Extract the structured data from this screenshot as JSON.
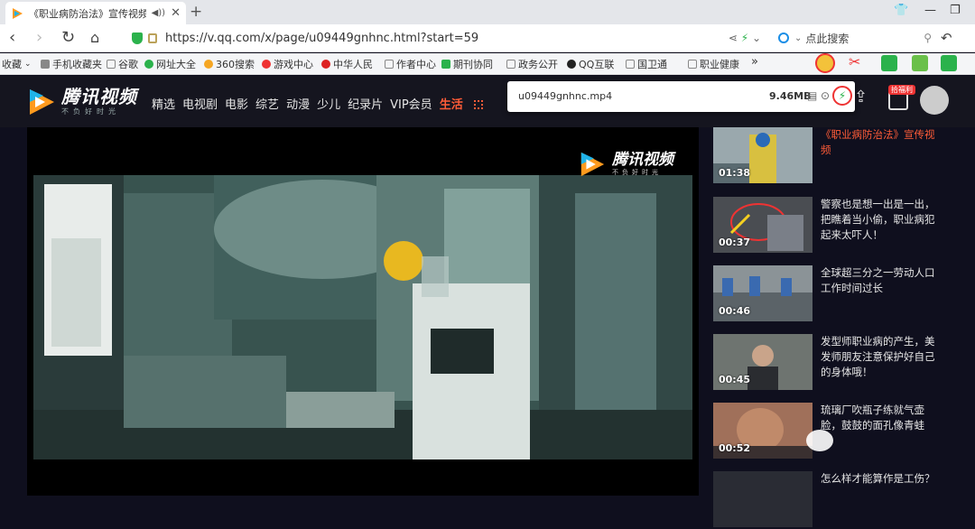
{
  "browser": {
    "tab_title": "《职业病防治法》宣传视频",
    "url": "https://v.qq.com/x/page/u09449gnhnc.html?start=59",
    "search_placeholder": "点此搜索"
  },
  "bookmarks": [
    "收藏",
    "手机收藏夹",
    "谷歌",
    "网址大全",
    "360搜索",
    "游戏中心",
    "中华人民",
    "作者中心",
    "期刊协同",
    "政务公开",
    "QQ互联",
    "国卫通",
    "职业健康"
  ],
  "bookmark_more": "»",
  "site": {
    "logo_text": "腾讯视频",
    "logo_slogan": "不负好时光",
    "nav": [
      "精选",
      "电视剧",
      "电影",
      "综艺",
      "动漫",
      "少儿",
      "纪录片",
      "VIP会员"
    ],
    "nav_hot": "生活",
    "badge": "拾福利"
  },
  "download": {
    "filename": "u09449gnhnc.mp4",
    "size": "9.46MB"
  },
  "player": {
    "watermark_text": "腾讯视频",
    "watermark_sub": "不负好时光"
  },
  "playlist": [
    {
      "title": "《职业病防治法》宣传视频",
      "duration": "01:38",
      "active": true
    },
    {
      "title": "警察也是想一出是一出，把瞧着当小偷，职业病犯起来太吓人！",
      "duration": "00:37",
      "active": false
    },
    {
      "title": "全球超三分之一劳动人口工作时间过长",
      "duration": "00:46",
      "active": false
    },
    {
      "title": "发型师职业病的产生，美发师朋友注意保护好自己的身体哦！",
      "duration": "00:45",
      "active": false
    },
    {
      "title": "琉璃厂吹瓶子练就气壶脸，鼓鼓的面孔像青蛙",
      "duration": "00:52",
      "active": false
    },
    {
      "title": "怎么样才能算作是工伤？",
      "duration": "",
      "active": false
    }
  ],
  "colors": {
    "accent": "#ff5c38",
    "header_bg": "#15151f",
    "page_bg": "#0f0f1e"
  }
}
